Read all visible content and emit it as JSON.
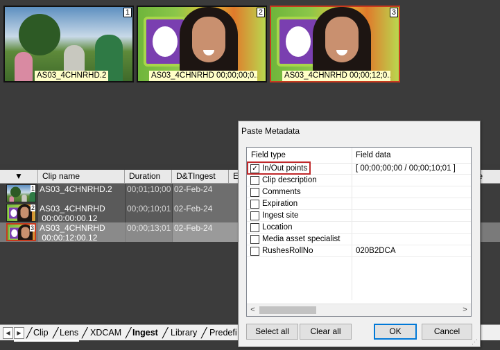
{
  "thumbnails": [
    {
      "number": "1",
      "caption": "AS03_4CHNRHD.2"
    },
    {
      "number": "2",
      "caption": "AS03_4CHNRHD 00;00;00;0..."
    },
    {
      "number": "3",
      "caption": "AS03_4CHNRHD 00;00;12;0..."
    }
  ],
  "clip_list": {
    "sort_arrow": "▼",
    "columns": [
      "Clip name",
      "Duration",
      "D&TIngest",
      "E",
      "te"
    ],
    "rows": [
      {
        "num": "1",
        "name": "AS03_4CHNRHD.2",
        "duration": "00;01;10;00",
        "ingest": "02-Feb-24"
      },
      {
        "num": "2",
        "name": "AS03_4CHNRHD\n 00:00:00:00.12",
        "duration": "00;00;10;01",
        "ingest": "02-Feb-24"
      },
      {
        "num": "3",
        "name": "AS03_4CHNRHD\n 00:00:12:00.12",
        "duration": "00;00;13;01",
        "ingest": "02-Feb-24"
      }
    ]
  },
  "tabs": {
    "prev": "◀",
    "next": "▶",
    "items": [
      "Clip",
      "Lens",
      "XDCAM",
      "Ingest",
      "Library",
      "Predefi"
    ],
    "active": "Ingest"
  },
  "dialog": {
    "title": "Paste Metadata",
    "col_field_type": "Field type",
    "col_field_data": "Field data",
    "rows": [
      {
        "label": "In/Out points",
        "checked": true,
        "data": "[ 00;00;00;00 / 00;00;10;01 ]"
      },
      {
        "label": "Clip description",
        "checked": false,
        "data": ""
      },
      {
        "label": "Comments",
        "checked": false,
        "data": ""
      },
      {
        "label": "Expiration",
        "checked": false,
        "data": ""
      },
      {
        "label": "Ingest site",
        "checked": false,
        "data": ""
      },
      {
        "label": "Location",
        "checked": false,
        "data": ""
      },
      {
        "label": "Media asset specialist",
        "checked": false,
        "data": ""
      },
      {
        "label": "RushesRollNo",
        "checked": false,
        "data": "020B2DCA"
      }
    ],
    "buttons": {
      "select_all": "Select all",
      "clear_all": "Clear all",
      "ok": "OK",
      "cancel": "Cancel"
    },
    "check_glyph": "✓",
    "highlight_color": "#c0282a"
  },
  "colors": {
    "selection": "#c83a1e",
    "caption_bg": "#ffffc8",
    "row_dark": "#5a5a5a",
    "row_mid": "#6e6e6e"
  }
}
